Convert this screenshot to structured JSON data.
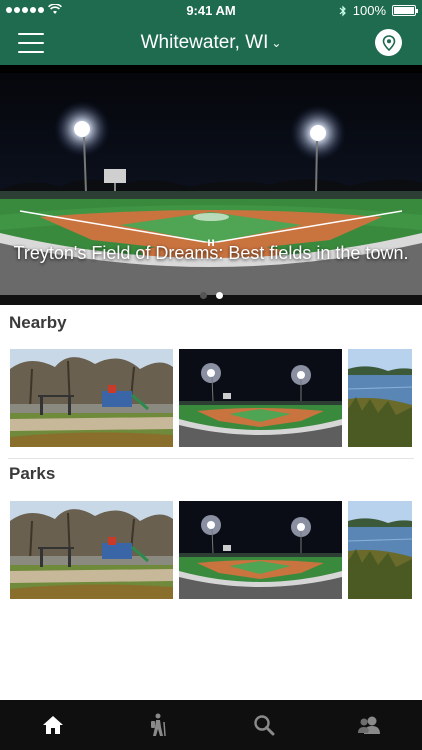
{
  "status_bar": {
    "time": "9:41 AM",
    "battery": "100%",
    "battery_level": 1.0
  },
  "nav": {
    "title": "Whitewater, WI",
    "chevron": "⌄",
    "menu_icon": "hamburger-menu-icon",
    "location_icon": "location-pin-icon"
  },
  "hero": {
    "caption": "Treyton's Field of Dreams: Best fields in the town.",
    "page_count": 2,
    "active_page": 2
  },
  "sections": [
    {
      "title": "Nearby",
      "items": [
        "playground-photo",
        "baseball-field-photo",
        "lake-photo"
      ]
    },
    {
      "title": "Parks",
      "items": [
        "playground-photo",
        "baseball-field-photo",
        "lake-photo"
      ]
    }
  ],
  "tabs": [
    {
      "icon": "home-icon",
      "active": true
    },
    {
      "icon": "hiker-icon",
      "active": false
    },
    {
      "icon": "search-icon",
      "active": false
    },
    {
      "icon": "users-icon",
      "active": false
    }
  ],
  "colors": {
    "brand_green": "#1e6b4f",
    "tab_bar": "#0f0f0f",
    "tab_active": "#ffffff",
    "tab_inactive": "#8a8a8a"
  }
}
